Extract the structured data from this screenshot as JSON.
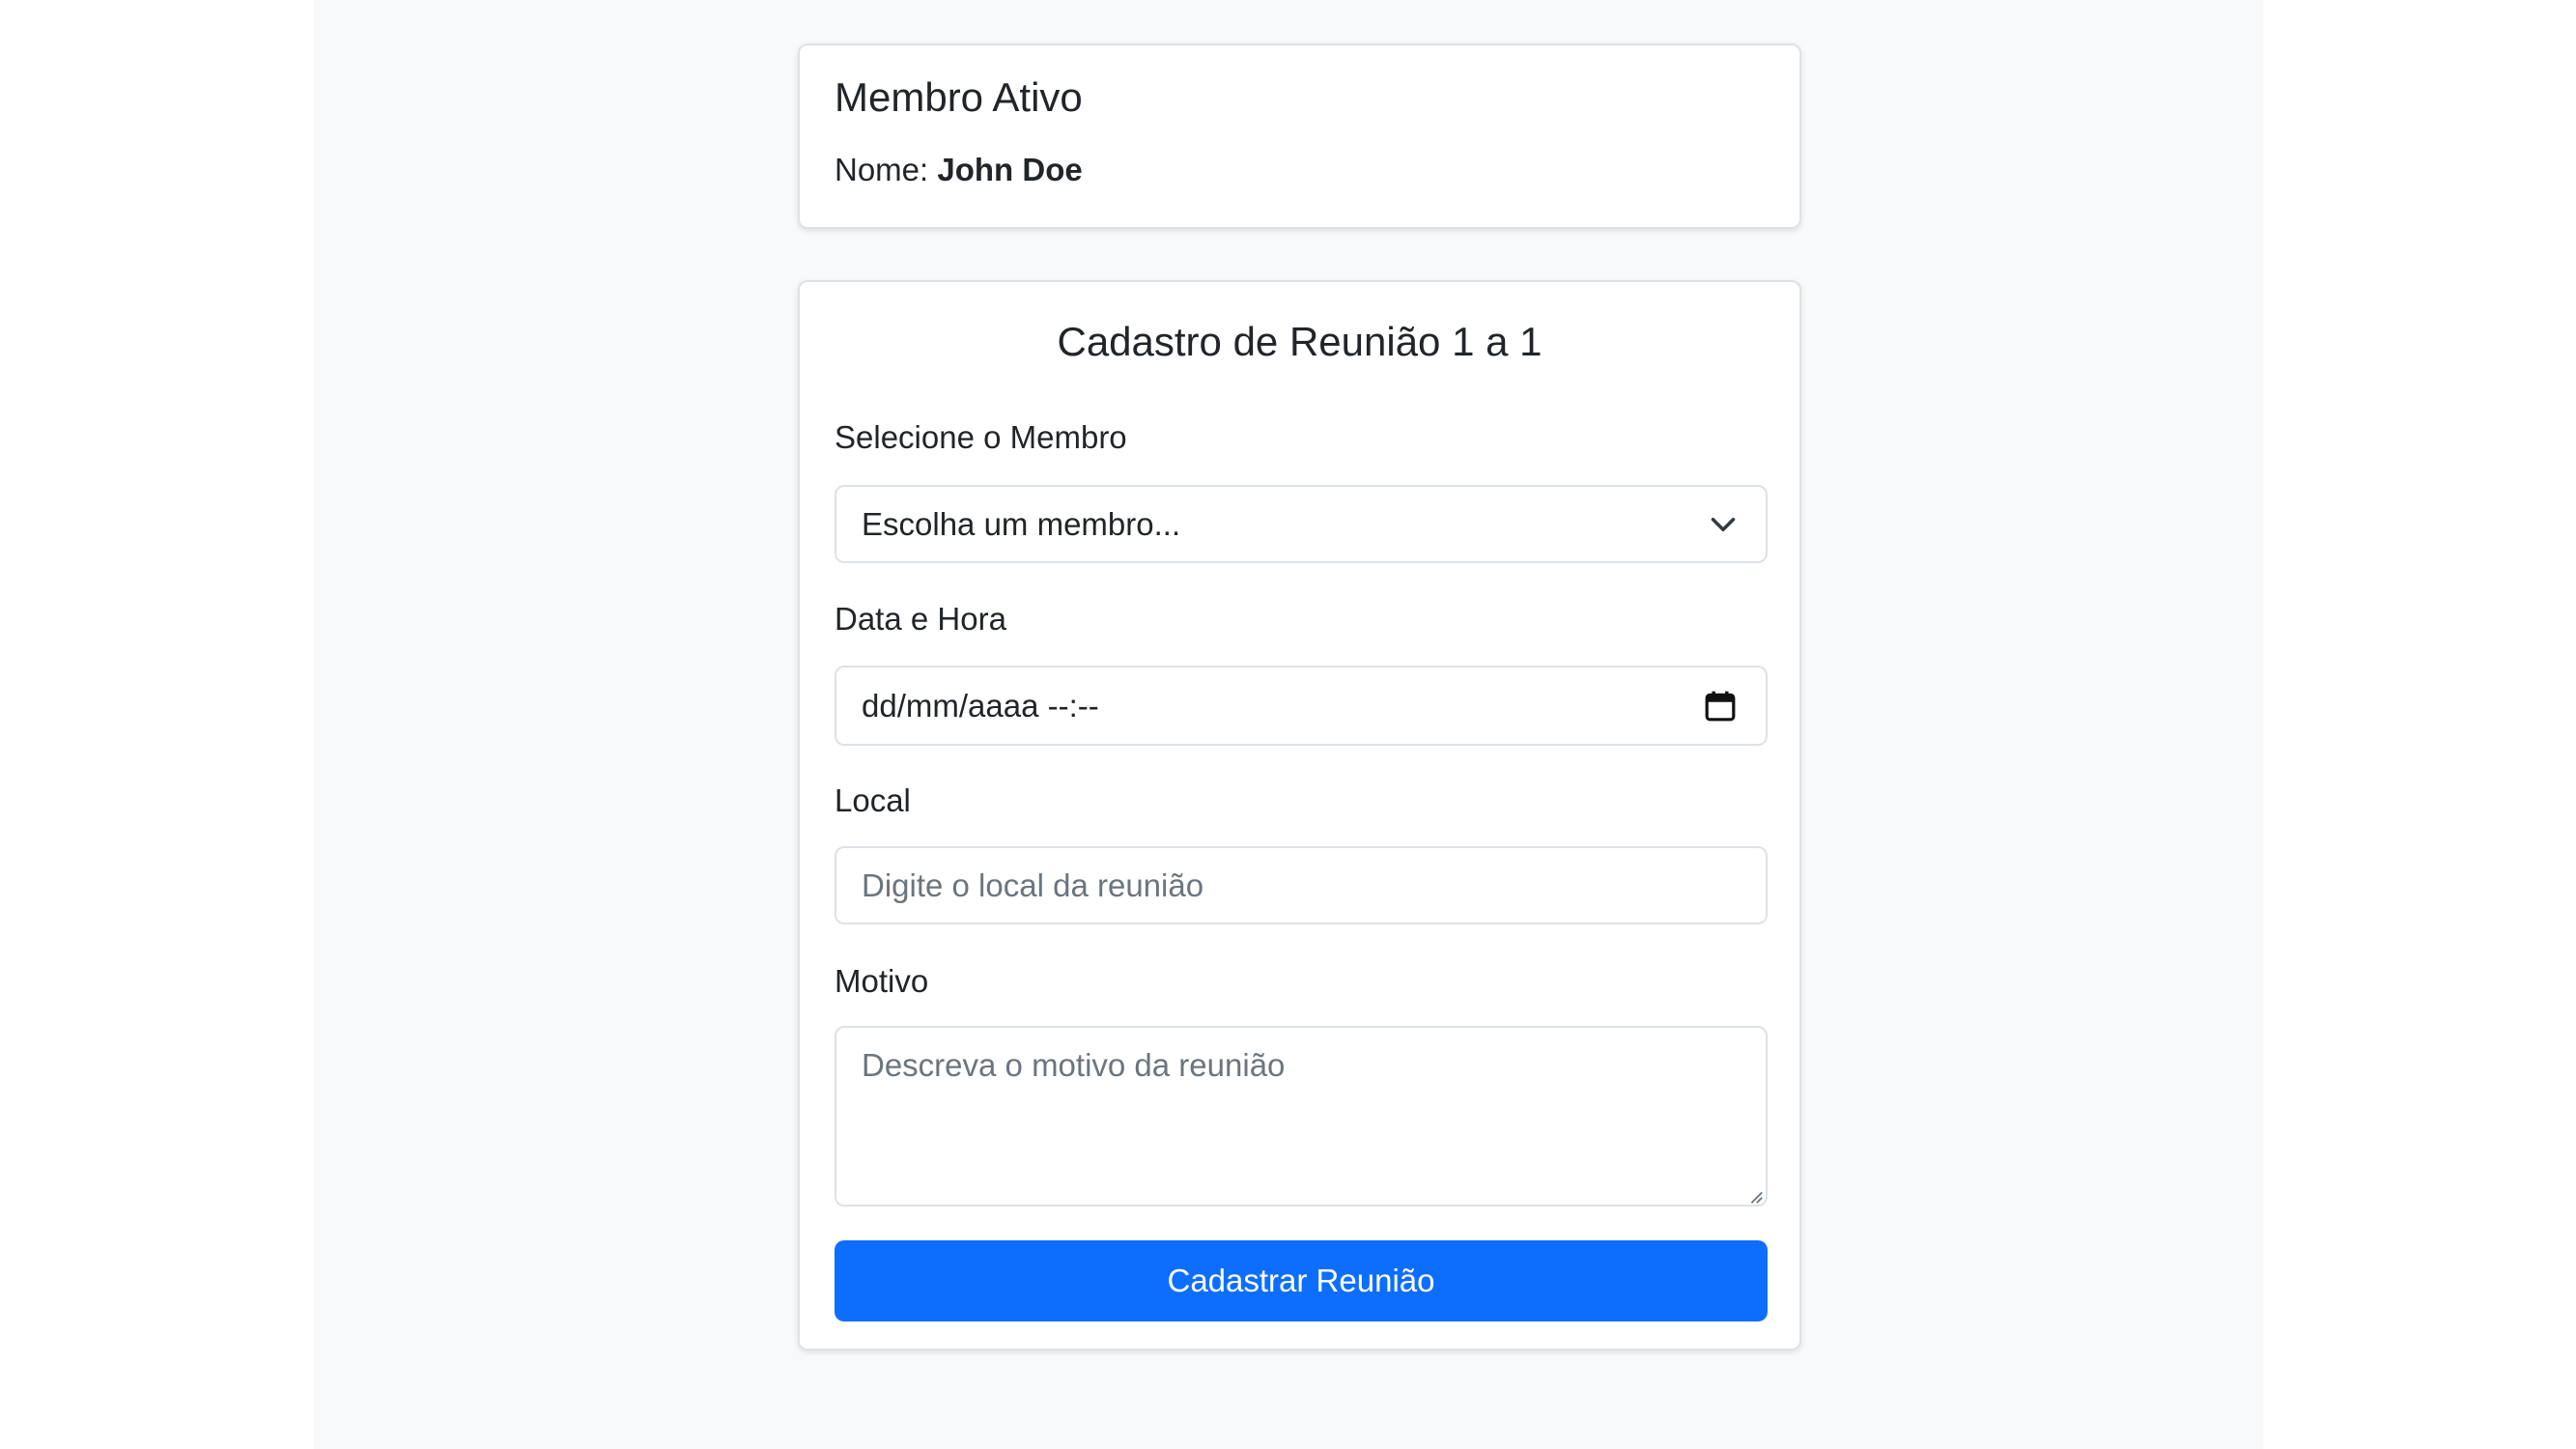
{
  "member_card": {
    "title": "Membro Ativo",
    "name_label": "Nome:",
    "name_value": "John Doe"
  },
  "form": {
    "title": "Cadastro de Reunião 1 a 1",
    "member_label": "Selecione o Membro",
    "member_selected": "Escolha um membro...",
    "datetime_label": "Data e Hora",
    "datetime_placeholder": "dd/mm/aaaa --:--",
    "local_label": "Local",
    "local_placeholder": "Digite o local da reunião",
    "reason_label": "Motivo",
    "reason_placeholder": "Descreva o motivo da reunião",
    "submit_label": "Cadastrar Reunião"
  },
  "colors": {
    "page_background": "#f8f9fa",
    "card_border": "#dee2e6",
    "primary": "#0d6efd",
    "text": "#212529",
    "placeholder": "#6c757d"
  },
  "icons": {
    "select": "chevron-down-icon",
    "datetime": "calendar-icon",
    "textarea": "resize-handle-icon"
  }
}
